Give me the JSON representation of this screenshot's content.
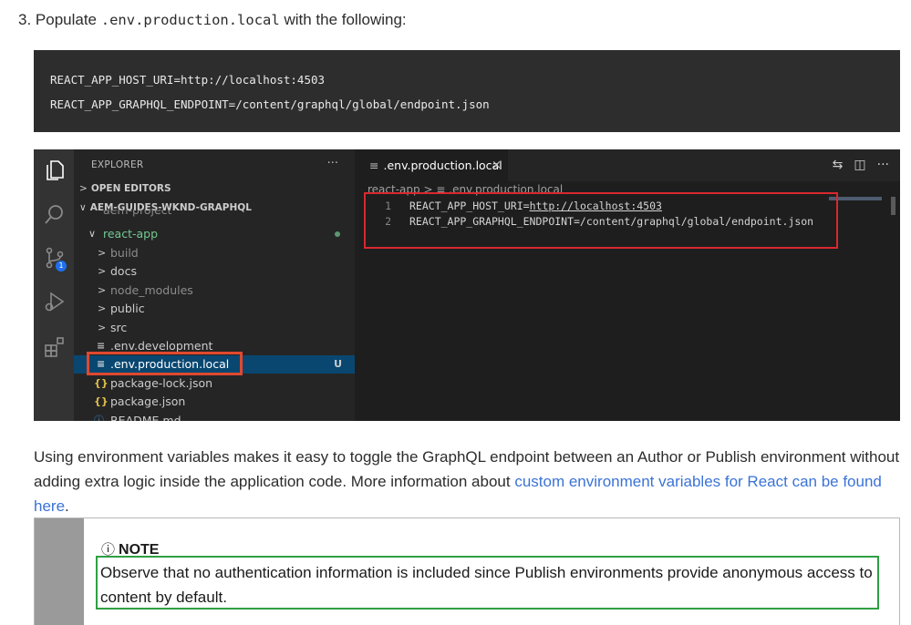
{
  "step": {
    "prefix": "3. Populate ",
    "filename": ".env.production.local",
    "suffix": " with the following:"
  },
  "code_block": {
    "lines": [
      "REACT_APP_HOST_URI=http://localhost:4503",
      "REACT_APP_GRAPHQL_ENDPOINT=/content/graphql/global/endpoint.json"
    ]
  },
  "vscode": {
    "explorer_title": "EXPLORER",
    "more": "···",
    "sections": {
      "open_editors": "OPEN EDITORS",
      "project": "AEM-GUIDES-WKND-GRAPHQL",
      "cut_off": "aem-project"
    },
    "tree": {
      "react_app": "react-app",
      "build": "build",
      "docs": "docs",
      "node_modules": "node_modules",
      "public": "public",
      "src": "src",
      "env_development": ".env.development",
      "env_production_local": ".env.production.local",
      "package_lock": "package-lock.json",
      "package_json": "package.json",
      "readme": "README.md",
      "untracked": "U",
      "lines_icon": "≡",
      "json_icon": "{}",
      "info_icon": "ⓘ"
    },
    "scm_badge": "1",
    "tab": {
      "label": ".env.production.local",
      "close": "×"
    },
    "breadcrumb": {
      "folder": "react-app",
      "sep": ">",
      "file": ".env.production.local"
    },
    "editor_lines": [
      {
        "num": "1",
        "key": "REACT_APP_HOST_URI=",
        "link": "http://localhost:4503"
      },
      {
        "num": "2",
        "key": "REACT_APP_GRAPHQL_ENDPOINT=/content/graphql/global/endpoint.json",
        "link": ""
      }
    ]
  },
  "paragraph": {
    "text": "Using environment variables makes it easy to toggle the GraphQL endpoint between an Author or Publish environment without adding extra logic inside the application code. More information about ",
    "link": "custom environment variables for React can be found here",
    "end": "."
  },
  "note": {
    "icon": "ⓘ",
    "title": "NOTE",
    "body": "Observe that no authentication information is included since Publish environments provide anonymous access to content by default."
  },
  "colors": {
    "code_bg": "#2d2d2d",
    "link": "#3b73d6",
    "highlight_red": "#d9282e",
    "highlight_orange": "#e0492f",
    "highlight_green": "#2ea043",
    "selection": "#094771"
  }
}
